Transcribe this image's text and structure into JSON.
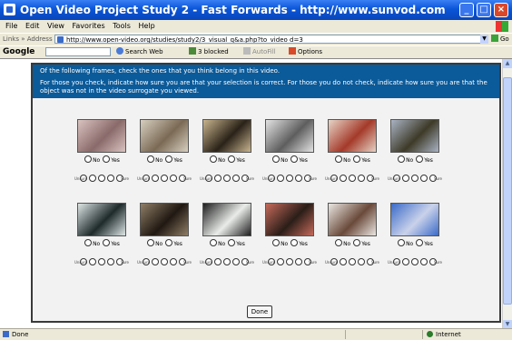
{
  "window": {
    "title": "Open Video Project Study 2 - Fast Forwards - http://www.sunvod.com"
  },
  "menu": [
    "File",
    "Edit",
    "View",
    "Favorites",
    "Tools",
    "Help"
  ],
  "address": {
    "label": "Links » Address",
    "url": "http://www.open-video.org/studies/study2/3_visual_q&a.php?to_video d=3",
    "go_label": "Go"
  },
  "google_toolbar": {
    "logo": "Google",
    "search_web": "Search Web",
    "blocked": "3 blocked",
    "autofill": "AutoFill",
    "options": "Options"
  },
  "instructions": {
    "line1": "Of the following frames, check the ones that you think belong in this video.",
    "line2": "For those you check, indicate how sure you are that your selection is correct. For those you do not check, indicate how sure you are that the object was not in the video surrogate you viewed."
  },
  "labels": {
    "no": "No",
    "yes": "Yes",
    "unsure": "Unsure",
    "sure": "Sure"
  },
  "frames": [
    {
      "icon": "frame-pink-speckled",
      "colors": [
        "#8a6a6a",
        "#d9c3c0"
      ]
    },
    {
      "icon": "frame-rubble-pile",
      "colors": [
        "#7a6a55",
        "#d8cfc0"
      ]
    },
    {
      "icon": "frame-statue-head",
      "colors": [
        "#2a2218",
        "#c8b48e"
      ]
    },
    {
      "icon": "frame-silver-disc",
      "colors": [
        "#5e5e5e",
        "#e3e3e3"
      ]
    },
    {
      "icon": "frame-group-people",
      "colors": [
        "#a43a2a",
        "#e6d4c6"
      ]
    },
    {
      "icon": "frame-outdoor-tree",
      "colors": [
        "#3e3a28",
        "#a9b3c3"
      ]
    },
    {
      "icon": "frame-white-sphere",
      "colors": [
        "#1e2a2a",
        "#dfe6e6"
      ]
    },
    {
      "icon": "frame-crowd-dark",
      "colors": [
        "#201812",
        "#8f7e66"
      ]
    },
    {
      "icon": "frame-machinery",
      "colors": [
        "#e9ece9",
        "#1e1e1e"
      ]
    },
    {
      "icon": "frame-people-indoor",
      "colors": [
        "#2a1e18",
        "#c46a5a"
      ]
    },
    {
      "icon": "frame-snowy-landscape",
      "colors": [
        "#6a4a3a",
        "#eae6e2"
      ]
    },
    {
      "icon": "frame-blue-figure",
      "colors": [
        "#c9d2e9",
        "#3a6bc8"
      ]
    }
  ],
  "done_button": "Done",
  "status": {
    "text": "Done",
    "zone": "Internet"
  }
}
